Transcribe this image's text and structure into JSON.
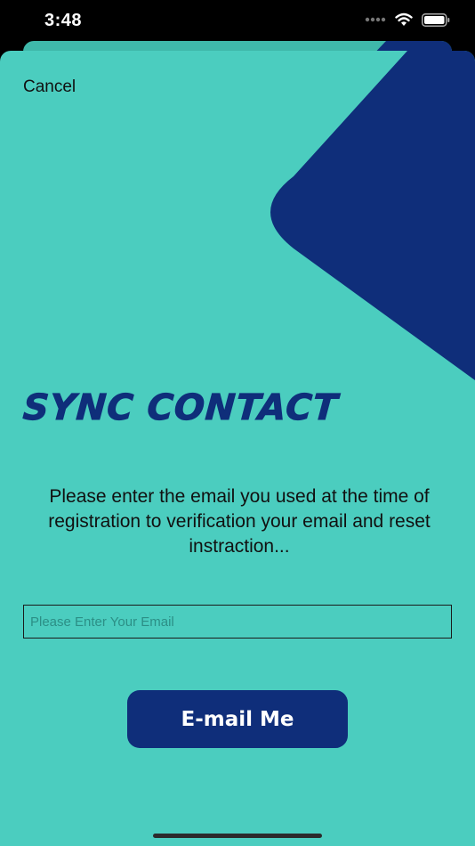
{
  "status_bar": {
    "time": "3:48"
  },
  "header": {
    "cancel_label": "Cancel"
  },
  "main": {
    "title": "SYNC CONTACT",
    "instruction": "Please enter the email you used at the time of registration to verification your email and reset instraction...",
    "email_field": {
      "value": "",
      "placeholder": "Please Enter Your Email"
    },
    "submit_label": "E-mail Me"
  },
  "colors": {
    "background": "#4bcdbf",
    "accent": "#0f2e7a",
    "text": "#111111"
  },
  "icons": [
    "cellular-signal-icon",
    "wifi-icon",
    "battery-icon"
  ]
}
